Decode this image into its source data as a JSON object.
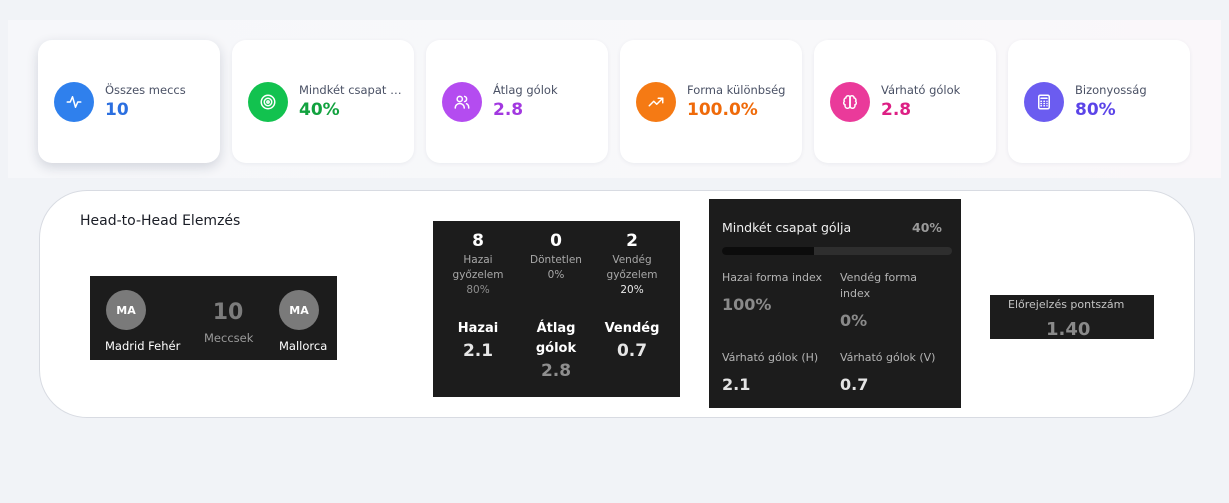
{
  "stats": [
    {
      "label": "Összes meccs",
      "value": "10",
      "icon": "activity-icon",
      "icon_bg": "#2f80ed",
      "value_color": "#2b6fe0"
    },
    {
      "label": "Mindkét csapat gólja",
      "value": "40%",
      "icon": "target-icon",
      "icon_bg": "#12c24f",
      "value_color": "#12a23f"
    },
    {
      "label": "Átlag gólok",
      "value": "2.8",
      "icon": "users-icon",
      "icon_bg": "#b44cf0",
      "value_color": "#a238e0"
    },
    {
      "label": "Forma különbség",
      "value": "100.0%",
      "icon": "trending-up-icon",
      "icon_bg": "#f57a14",
      "value_color": "#ef6a0a"
    },
    {
      "label": "Várható gólok",
      "value": "2.8",
      "icon": "brain-icon",
      "icon_bg": "#ea3a9a",
      "value_color": "#dd1f84"
    },
    {
      "label": "Bizonyosság",
      "value": "80%",
      "icon": "calculator-icon",
      "icon_bg": "#6b5cf0",
      "value_color": "#5b44e8"
    }
  ],
  "h2h": {
    "title": "Head-to-Head Elemzés",
    "home": {
      "initials": "MA",
      "name": "Madrid Fehér"
    },
    "away": {
      "initials": "MA",
      "name": "Mallorca"
    },
    "matches": {
      "count": "10",
      "label": "Meccsek"
    },
    "results": {
      "home_wins": {
        "value": "8",
        "label1": "Hazai",
        "label2": "győzelem",
        "pct": "80%"
      },
      "draws": {
        "value": "0",
        "label1": "Döntetlen",
        "pct": "0%"
      },
      "away_wins": {
        "value": "2",
        "label1": "Vendég",
        "label2": "győzelem",
        "pct": "20%"
      }
    },
    "goals": {
      "home_label": "Hazai",
      "home_value": "2.1",
      "avg_label1": "Átlag",
      "avg_label2": "gólok",
      "avg_value": "2.8",
      "away_label": "Vendég",
      "away_value": "0.7"
    },
    "btts": {
      "label": "Mindkét csapat gólja",
      "value": "40%",
      "fill": 0.4
    },
    "form": {
      "home_label": "Hazai forma index",
      "home_value": "100%",
      "away_label1": "Vendég forma",
      "away_label2": "index",
      "away_value": "0%",
      "xg_home_label": "Várható gólok (H)",
      "xg_home_value": "2.1",
      "xg_away_label": "Várható gólok (V)",
      "xg_away_value": "0.7"
    },
    "prediction": {
      "label": "Előrejelzés pontszám",
      "value": "1.40"
    }
  }
}
